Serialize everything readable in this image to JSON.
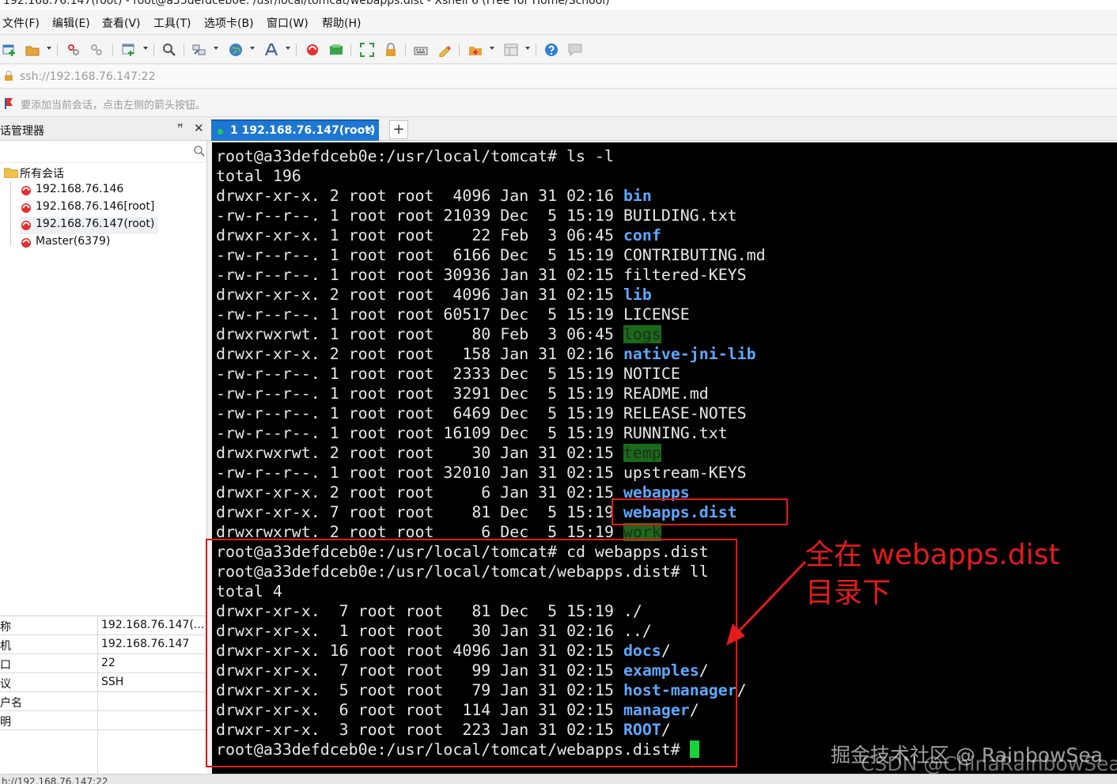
{
  "window": {
    "title": "192.168.76.147(root) - root@a33defdceb0e: /usr/local/tomcat/webapps.dist - Xshell 6 (Free for Home/School)"
  },
  "menu": [
    "文件(F)",
    "编辑(E)",
    "查看(V)",
    "工具(T)",
    "选项卡(B)",
    "窗口(W)",
    "帮助(H)"
  ],
  "toolbar": {
    "icons": [
      "new-session-icon",
      "open-folder-icon",
      "reconnect-icon",
      "disconnect-icon",
      "new-window-icon",
      "find-icon",
      "transfer-icon",
      "globe-icon",
      "font-icon",
      "xshell-icon",
      "xftp-icon",
      "fullscreen-icon",
      "lock-icon",
      "keyboard-icon",
      "script-icon",
      "compose-icon",
      "layout-icon",
      "help-icon",
      "chat-icon"
    ]
  },
  "address": {
    "text": "ssh://192.168.76.147:22"
  },
  "hint": {
    "text": "要添加当前会话，点击左侧的箭头按钮。"
  },
  "sidebar": {
    "title": "话管理器",
    "pin": "ꟸ",
    "close": "✕",
    "root_label": "所有会话",
    "sessions": [
      "192.168.76.146",
      "192.168.76.146[root]",
      "192.168.76.147(root)",
      "Master(6379)"
    ]
  },
  "properties": [
    {
      "key": "称",
      "value": "192.168.76.147(..."
    },
    {
      "key": "机",
      "value": "192.168.76.147"
    },
    {
      "key": "口",
      "value": "22"
    },
    {
      "key": "议",
      "value": "SSH"
    },
    {
      "key": "户名",
      "value": ""
    },
    {
      "key": "明",
      "value": ""
    }
  ],
  "tab": {
    "label": "1 192.168.76.147(root)",
    "close": "×",
    "add": "+"
  },
  "terminal": {
    "lines": [
      {
        "t": "root@a33defdceb0e:/usr/local/tomcat# ls -l"
      },
      {
        "t": "total 196"
      },
      {
        "t": "drwxr-xr-x. 2 root root  4096 Jan 31 02:16 ",
        "name": "bin",
        "type": "dir"
      },
      {
        "t": "-rw-r--r--. 1 root root 21039 Dec  5 15:19 ",
        "name": "BUILDING.txt"
      },
      {
        "t": "drwxr-xr-x. 1 root root    22 Feb  3 06:45 ",
        "name": "conf",
        "type": "dir"
      },
      {
        "t": "-rw-r--r--. 1 root root  6166 Dec  5 15:19 ",
        "name": "CONTRIBUTING.md"
      },
      {
        "t": "-rw-r--r--. 1 root root 30936 Jan 31 02:15 ",
        "name": "filtered-KEYS"
      },
      {
        "t": "drwxr-xr-x. 2 root root  4096 Jan 31 02:15 ",
        "name": "lib",
        "type": "dir"
      },
      {
        "t": "-rw-r--r--. 1 root root 60517 Dec  5 15:19 ",
        "name": "LICENSE"
      },
      {
        "t": "drwxrwxrwt. 1 root root    80 Feb  3 06:45 ",
        "name": "logs",
        "type": "hl"
      },
      {
        "t": "drwxr-xr-x. 2 root root   158 Jan 31 02:16 ",
        "name": "native-jni-lib",
        "type": "dir"
      },
      {
        "t": "-rw-r--r--. 1 root root  2333 Dec  5 15:19 ",
        "name": "NOTICE"
      },
      {
        "t": "-rw-r--r--. 1 root root  3291 Dec  5 15:19 ",
        "name": "README.md"
      },
      {
        "t": "-rw-r--r--. 1 root root  6469 Dec  5 15:19 ",
        "name": "RELEASE-NOTES"
      },
      {
        "t": "-rw-r--r--. 1 root root 16109 Dec  5 15:19 ",
        "name": "RUNNING.txt"
      },
      {
        "t": "drwxrwxrwt. 2 root root    30 Jan 31 02:15 ",
        "name": "temp",
        "type": "hl"
      },
      {
        "t": "-rw-r--r--. 1 root root 32010 Jan 31 02:15 ",
        "name": "upstream-KEYS"
      },
      {
        "t": "drwxr-xr-x. 2 root root     6 Jan 31 02:15 ",
        "name": "webapps",
        "type": "dir"
      },
      {
        "t": "drwxr-xr-x. 7 root root    81 Dec  5 15:19 ",
        "name": "webapps.dist",
        "type": "dir"
      },
      {
        "t": "drwxrwxrwt. 2 root root     6 Dec  5 15:19 ",
        "name": "work",
        "type": "hl"
      },
      {
        "t": "root@a33defdceb0e:/usr/local/tomcat# cd webapps.dist"
      },
      {
        "t": "root@a33defdceb0e:/usr/local/tomcat/webapps.dist# ll"
      },
      {
        "t": "total 4"
      },
      {
        "t": "drwxr-xr-x.  7 root root   81 Dec  5 15:19 ./"
      },
      {
        "t": "drwxr-xr-x.  1 root root   30 Jan 31 02:16 ../"
      },
      {
        "t": "drwxr-xr-x. 16 root root 4096 Jan 31 02:15 ",
        "name": "docs",
        "type": "dir",
        "suffix": "/"
      },
      {
        "t": "drwxr-xr-x.  7 root root   99 Jan 31 02:15 ",
        "name": "examples",
        "type": "dir",
        "suffix": "/"
      },
      {
        "t": "drwxr-xr-x.  5 root root   79 Jan 31 02:15 ",
        "name": "host-manager",
        "type": "dir",
        "suffix": "/"
      },
      {
        "t": "drwxr-xr-x.  6 root root  114 Jan 31 02:15 ",
        "name": "manager",
        "type": "dir",
        "suffix": "/"
      },
      {
        "t": "drwxr-xr-x.  3 root root  223 Jan 31 02:15 ",
        "name": "ROOT",
        "type": "dir",
        "suffix": "/"
      },
      {
        "t": "root@a33defdceb0e:/usr/local/tomcat/webapps.dist# ",
        "cursor": true
      }
    ]
  },
  "annotation": {
    "line1": "全在 webapps.dist",
    "line2": "目录下"
  },
  "watermark": {
    "line1": "掘金技术社区 @ RainbowSea",
    "line2": "CSDN @ChinaRainbowSea"
  },
  "statusbar": {
    "text": "h://192.168.76.147:22"
  },
  "colors": {
    "accent": "#1e77d3",
    "terminal_bg": "#000000",
    "dir": "#5da8ff",
    "highlight": "#1a6a1a",
    "annotation": "#e31b1b"
  }
}
